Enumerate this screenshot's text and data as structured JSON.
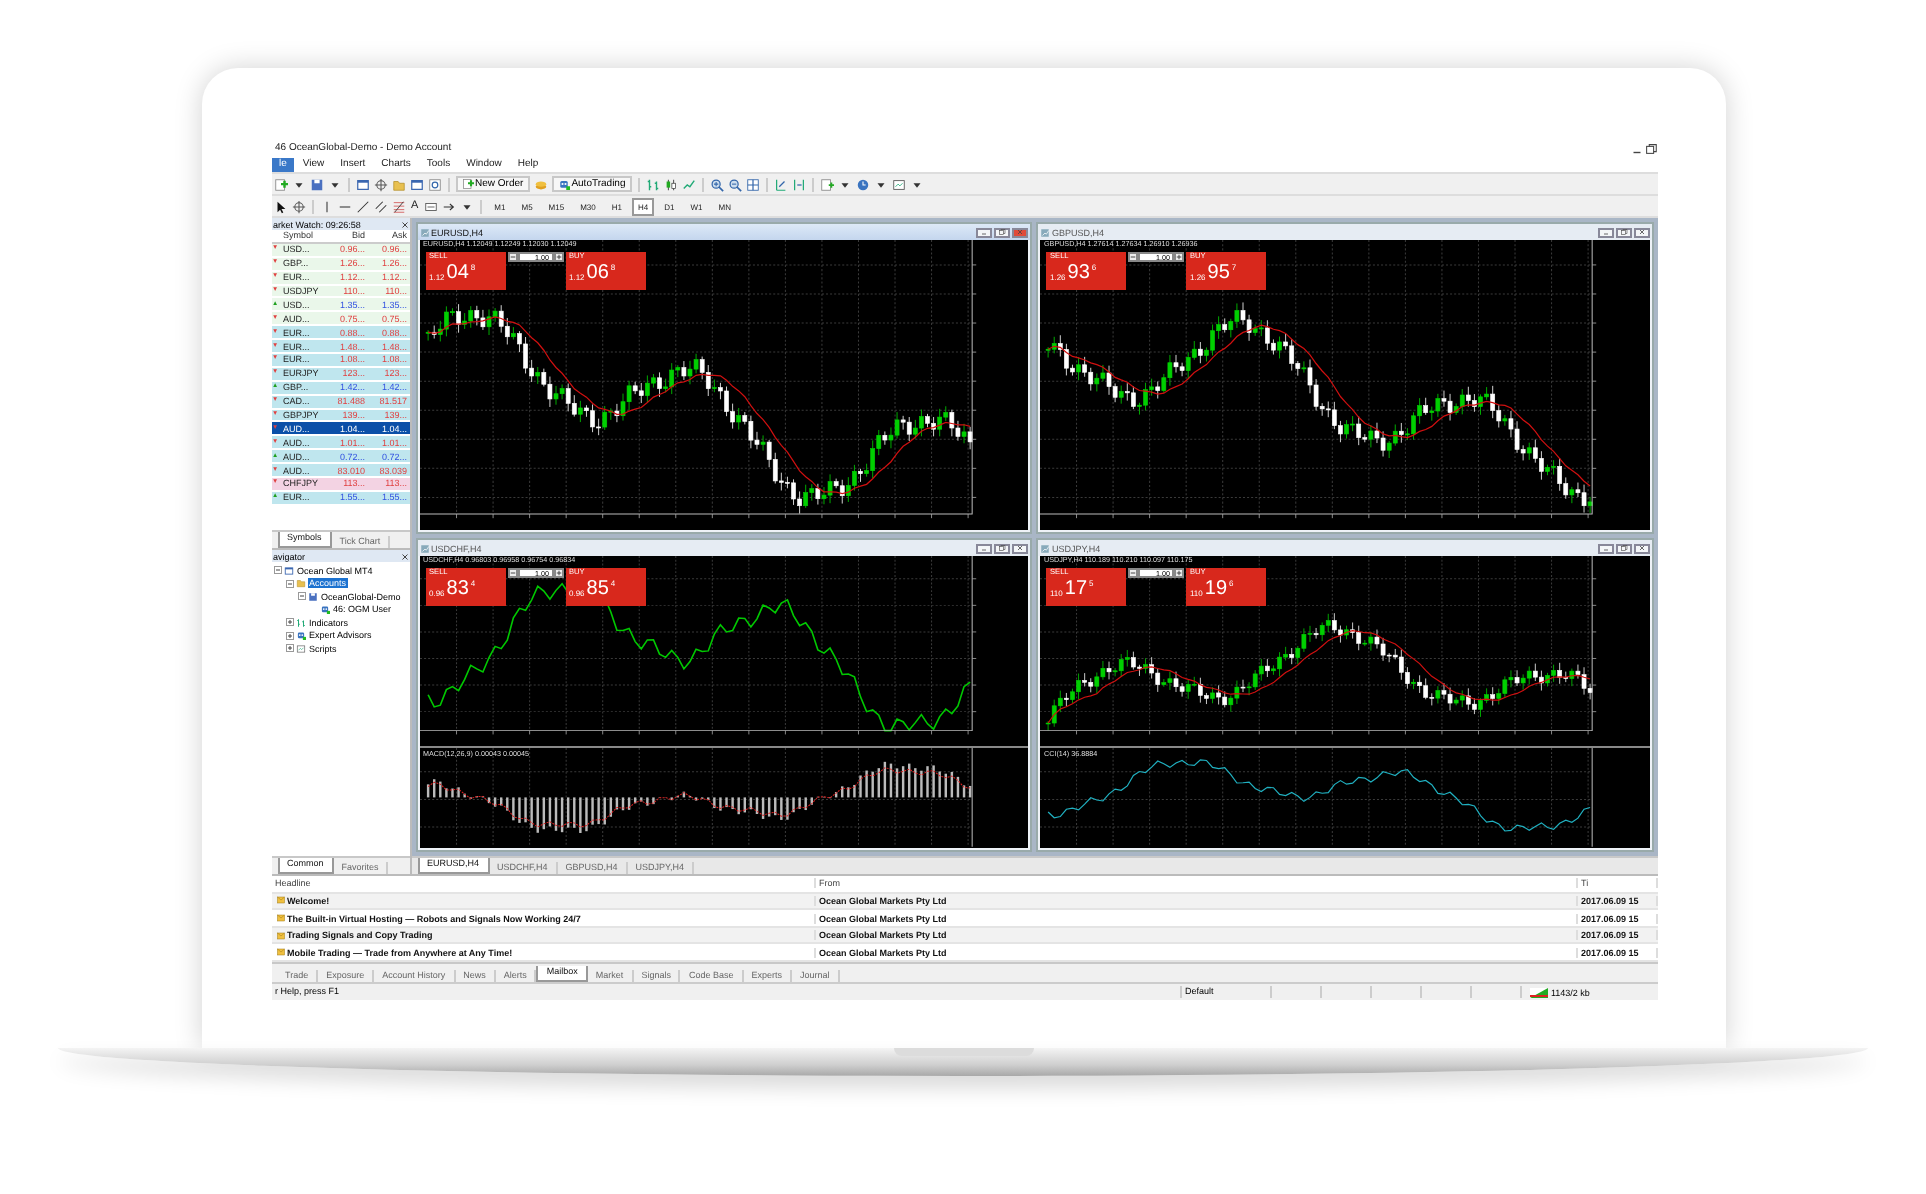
{
  "window": {
    "title": "46 OceanGlobal-Demo - Demo Account"
  },
  "menu": [
    {
      "label": "le",
      "selected": true
    },
    {
      "label": "View",
      "selected": false
    },
    {
      "label": "Insert",
      "selected": false
    },
    {
      "label": "Charts",
      "selected": false
    },
    {
      "label": "Tools",
      "selected": false
    },
    {
      "label": "Window",
      "selected": false
    },
    {
      "label": "Help",
      "selected": false
    }
  ],
  "toolbar": {
    "buttons": [
      "New Order",
      "AutoTrading"
    ],
    "text_tool": "A",
    "timeframes": [
      {
        "label": "M1",
        "selected": false
      },
      {
        "label": "M5",
        "selected": false
      },
      {
        "label": "M15",
        "selected": false
      },
      {
        "label": "M30",
        "selected": false
      },
      {
        "label": "H1",
        "selected": false
      },
      {
        "label": "H4",
        "selected": true
      },
      {
        "label": "D1",
        "selected": false
      },
      {
        "label": "W1",
        "selected": false
      },
      {
        "label": "MN",
        "selected": false
      }
    ]
  },
  "market_watch": {
    "title": "arket Watch: 09:26:58",
    "columns": [
      "Symbol",
      "Bid",
      "Ask"
    ],
    "rows": [
      {
        "symbol": "USD...",
        "bid": "0.96...",
        "ask": "0.96...",
        "kind": "down",
        "color": "#eaf7ea",
        "selected": false
      },
      {
        "symbol": "GBP...",
        "bid": "1.26...",
        "ask": "1.26...",
        "kind": "down",
        "color": "#eaf7ea",
        "selected": false
      },
      {
        "symbol": "EUR...",
        "bid": "1.12...",
        "ask": "1.12...",
        "kind": "down",
        "color": "#eaf7ea",
        "selected": false
      },
      {
        "symbol": "USDJPY",
        "bid": "110...",
        "ask": "110...",
        "kind": "down",
        "color": "#eaf7ea",
        "selected": false
      },
      {
        "symbol": "USD...",
        "bid": "1.35...",
        "ask": "1.35...",
        "kind": "up",
        "color": "#eaf7ea",
        "selected": false
      },
      {
        "symbol": "AUD...",
        "bid": "0.75...",
        "ask": "0.75...",
        "kind": "down",
        "color": "#eaf7ea",
        "selected": false
      },
      {
        "symbol": "EUR...",
        "bid": "0.88...",
        "ask": "0.88...",
        "kind": "down",
        "color": "#bfe6ee",
        "selected": false
      },
      {
        "symbol": "EUR...",
        "bid": "1.48...",
        "ask": "1.48...",
        "kind": "down",
        "color": "#bfe6ee",
        "selected": false
      },
      {
        "symbol": "EUR...",
        "bid": "1.08...",
        "ask": "1.08...",
        "kind": "down",
        "color": "#bfe6ee",
        "selected": false
      },
      {
        "symbol": "EURJPY",
        "bid": "123...",
        "ask": "123...",
        "kind": "down",
        "color": "#bfe6ee",
        "selected": false
      },
      {
        "symbol": "GBP...",
        "bid": "1.42...",
        "ask": "1.42...",
        "kind": "up",
        "color": "#bfe6ee",
        "selected": false
      },
      {
        "symbol": "CAD...",
        "bid": "81.488",
        "ask": "81.517",
        "kind": "down",
        "color": "#bfe6ee",
        "selected": false
      },
      {
        "symbol": "GBPJPY",
        "bid": "139...",
        "ask": "139...",
        "kind": "down",
        "color": "#bfe6ee",
        "selected": false
      },
      {
        "symbol": "AUD...",
        "bid": "1.04...",
        "ask": "1.04...",
        "kind": "down",
        "selected": true
      },
      {
        "symbol": "AUD...",
        "bid": "1.01...",
        "ask": "1.01...",
        "kind": "down",
        "color": "#bfe6ee",
        "selected": false
      },
      {
        "symbol": "AUD...",
        "bid": "0.72...",
        "ask": "0.72...",
        "kind": "up",
        "color": "#bfe6ee",
        "selected": false
      },
      {
        "symbol": "AUD...",
        "bid": "83.010",
        "ask": "83.039",
        "kind": "down",
        "color": "#bfe6ee",
        "selected": false
      },
      {
        "symbol": "CHFJPY",
        "bid": "113...",
        "ask": "113...",
        "kind": "down",
        "color": "#f3d3e3",
        "selected": false
      },
      {
        "symbol": "EUR...",
        "bid": "1.55...",
        "ask": "1.55...",
        "kind": "up",
        "color": "#bfe6ee",
        "selected": false
      }
    ],
    "tabs": [
      {
        "label": "Symbols",
        "selected": true
      },
      {
        "label": "Tick Chart",
        "selected": false
      }
    ]
  },
  "navigator": {
    "title": "avigator",
    "tree": [
      {
        "label": "Ocean Global MT4",
        "kind": "terminal",
        "selected": false,
        "expanded": true,
        "children": [
          {
            "label": "Accounts",
            "kind": "accounts",
            "selected": true,
            "expanded": true,
            "children": [
              {
                "label": "OceanGlobal-Demo",
                "kind": "server",
                "selected": false,
                "expanded": true,
                "children": [
                  {
                    "label": "46: OGM User",
                    "kind": "user",
                    "selected": false
                  }
                ]
              }
            ]
          },
          {
            "label": "Indicators",
            "kind": "indicators",
            "selected": false,
            "expanded": false
          },
          {
            "label": "Expert Advisors",
            "kind": "experts",
            "selected": false,
            "expanded": false
          },
          {
            "label": "Scripts",
            "kind": "scripts",
            "selected": false,
            "expanded": false
          }
        ]
      }
    ],
    "tabs": [
      {
        "label": "Common",
        "selected": true
      },
      {
        "label": "Favorites",
        "selected": false
      }
    ]
  },
  "charts": [
    {
      "title": "EURUSD,H4",
      "active": true,
      "info": "EURUSD,H4  1.12049 1.12249 1.12030 1.12049",
      "kind": "candles",
      "lot": "1.00",
      "sell_label": "SELL",
      "buy_label": "BUY",
      "sell": {
        "big": "1.12",
        "pips": "04",
        "point": "8"
      },
      "buy": {
        "big": "1.12",
        "pips": "06",
        "point": "8"
      }
    },
    {
      "title": "GBPUSD,H4",
      "active": false,
      "info": "GBPUSD,H4  1.27614 1.27634 1.26910 1.26936",
      "kind": "candles",
      "lot": "1.00",
      "sell_label": "SELL",
      "buy_label": "BUY",
      "sell": {
        "big": "1.26",
        "pips": "93",
        "point": "6"
      },
      "buy": {
        "big": "1.26",
        "pips": "95",
        "point": "7"
      }
    },
    {
      "title": "USDCHF,H4",
      "active": false,
      "info": "USDCHF,H4  0.96803 0.96958 0.96754 0.96834",
      "kind": "line",
      "indicator": {
        "kind": "macd",
        "label": "MACD(12,26,9) 0.00043 0.00045"
      },
      "lot": "1.00",
      "sell_label": "SELL",
      "buy_label": "BUY",
      "sell": {
        "big": "0.96",
        "pips": "83",
        "point": "4"
      },
      "buy": {
        "big": "0.96",
        "pips": "85",
        "point": "4"
      }
    },
    {
      "title": "USDJPY,H4",
      "active": false,
      "info": "USDJPY,H4  110.189 110.210 110.097 110.175",
      "kind": "candles",
      "indicator": {
        "kind": "cci",
        "label": "CCI(14) 36.8884"
      },
      "lot": "1.00",
      "sell_label": "SELL",
      "buy_label": "BUY",
      "sell": {
        "big": "110",
        "pips": "17",
        "point": "5"
      },
      "buy": {
        "big": "110",
        "pips": "19",
        "point": "6"
      }
    }
  ],
  "chart_tabs": [
    {
      "label": "EURUSD,H4",
      "selected": true
    },
    {
      "label": "USDCHF,H4",
      "selected": false
    },
    {
      "label": "GBPUSD,H4",
      "selected": false
    },
    {
      "label": "USDJPY,H4",
      "selected": false
    }
  ],
  "terminal": {
    "columns": [
      "Headline",
      "From",
      "Ti"
    ],
    "rows": [
      {
        "headline": "Welcome!",
        "from": "Ocean Global Markets Pty Ltd",
        "time": "2017.06.09 15"
      },
      {
        "headline": "The Built-in Virtual Hosting — Robots and Signals Now Working 24/7",
        "from": "Ocean Global Markets Pty Ltd",
        "time": "2017.06.09 15"
      },
      {
        "headline": "Trading Signals and Copy Trading",
        "from": "Ocean Global Markets Pty Ltd",
        "time": "2017.06.09 15"
      },
      {
        "headline": "Mobile Trading — Trade from Anywhere at Any Time!",
        "from": "Ocean Global Markets Pty Ltd",
        "time": "2017.06.09 15"
      }
    ],
    "tabs": [
      {
        "label": "Trade",
        "selected": false
      },
      {
        "label": "Exposure",
        "selected": false
      },
      {
        "label": "Account History",
        "selected": false
      },
      {
        "label": "News",
        "selected": false
      },
      {
        "label": "Alerts",
        "selected": false
      },
      {
        "label": "Mailbox",
        "selected": true
      },
      {
        "label": "Market",
        "selected": false
      },
      {
        "label": "Signals",
        "selected": false
      },
      {
        "label": "Code Base",
        "selected": false
      },
      {
        "label": "Experts",
        "selected": false
      },
      {
        "label": "Journal",
        "selected": false
      }
    ]
  },
  "status_bar": {
    "help": "r Help, press F1",
    "profile": "Default",
    "traffic": "1143/2 kb"
  }
}
